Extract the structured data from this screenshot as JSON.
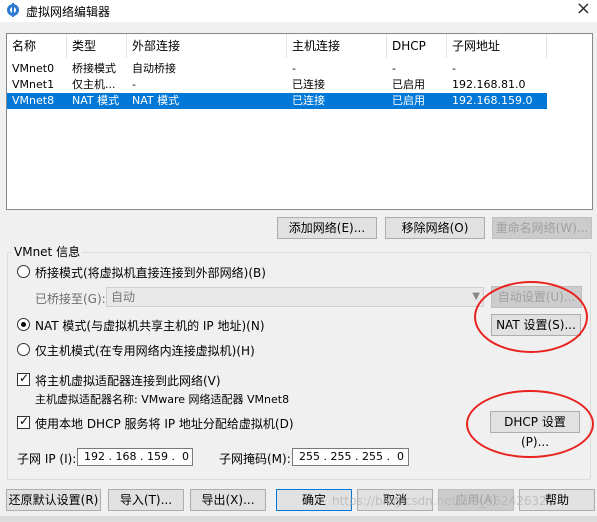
{
  "window": {
    "title": "虚拟网络编辑器",
    "close_glyph": "×"
  },
  "list": {
    "columns": [
      "名称",
      "类型",
      "外部连接",
      "主机连接",
      "DHCP",
      "子网地址"
    ],
    "rows": [
      {
        "name": "VMnet0",
        "type": "桥接模式",
        "external": "自动桥接",
        "host": "-",
        "dhcp": "-",
        "subnet": "-",
        "selected": false
      },
      {
        "name": "VMnet1",
        "type": "仅主机...",
        "external": "-",
        "host": "已连接",
        "dhcp": "已启用",
        "subnet": "192.168.81.0",
        "selected": false
      },
      {
        "name": "VMnet8",
        "type": "NAT 模式",
        "external": "NAT 模式",
        "host": "已连接",
        "dhcp": "已启用",
        "subnet": "192.168.159.0",
        "selected": true
      }
    ]
  },
  "list_buttons": {
    "add": "添加网络(E)...",
    "remove": "移除网络(O)",
    "rename": "重命名网络(W)..."
  },
  "vmnet_info": {
    "group_label": "VMnet 信息",
    "bridge_radio": "桥接模式(将虚拟机直接连接到外部网络)(B)",
    "bridged_to_label": "已桥接至(G):",
    "bridged_to_value": "自动",
    "auto_settings": "自动设置(U)...",
    "nat_radio": "NAT 模式(与虚拟机共享主机的 IP 地址)(N)",
    "nat_settings": "NAT 设置(S)...",
    "host_only_radio": "仅主机模式(在专用网络内连接虚拟机)(H)",
    "connect_adapter_check": "将主机虚拟适配器连接到此网络(V)",
    "adapter_name_line": "主机虚拟适配器名称: VMware 网络适配器 VMnet8",
    "dhcp_check": "使用本地 DHCP 服务将 IP 地址分配给虚拟机(D)",
    "dhcp_settings": "DHCP 设置(P)...",
    "subnet_ip_label": "子网 IP (I):",
    "subnet_ip_value": "192 . 168 . 159 .  0",
    "subnet_mask_label": "子网掩码(M):",
    "subnet_mask_value": "255 . 255 . 255 .  0"
  },
  "footer": {
    "restore": "还原默认设置(R)",
    "import": "导入(T)...",
    "export": "导出(X)...",
    "ok": "确定",
    "cancel": "取消",
    "apply": "应用(A)",
    "help": "帮助"
  },
  "watermark": "https://blog.csdn.net/m0_56242632",
  "colors": {
    "selection": "#0078d7",
    "annotation": "#e8231f"
  }
}
